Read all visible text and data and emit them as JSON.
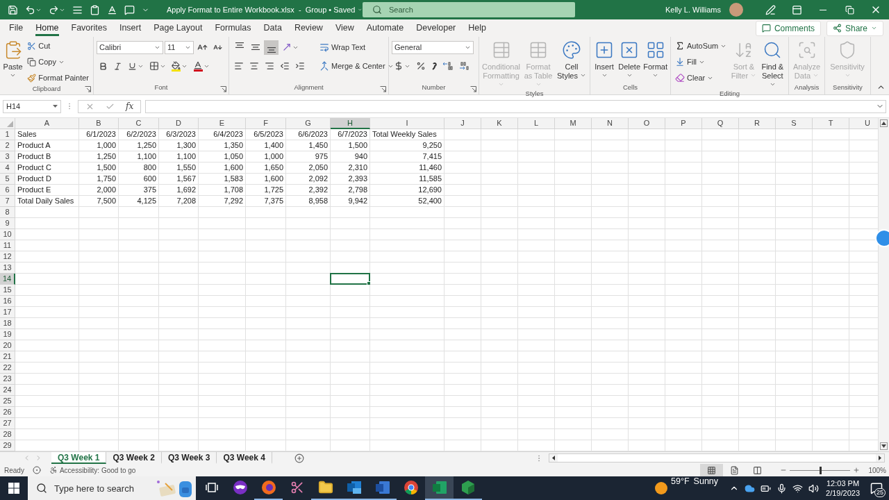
{
  "title_bar": {
    "title": "Apply Format to Entire Workbook.xlsx  -  Group • Saved",
    "search_placeholder": "Search",
    "user_name": "Kelly L. Williams"
  },
  "menu_tabs": [
    {
      "label": "File",
      "selected": false
    },
    {
      "label": "Home",
      "selected": true
    },
    {
      "label": "Favorites",
      "selected": false
    },
    {
      "label": "Insert",
      "selected": false
    },
    {
      "label": "Page Layout",
      "selected": false
    },
    {
      "label": "Formulas",
      "selected": false
    },
    {
      "label": "Data",
      "selected": false
    },
    {
      "label": "Review",
      "selected": false
    },
    {
      "label": "View",
      "selected": false
    },
    {
      "label": "Automate",
      "selected": false
    },
    {
      "label": "Developer",
      "selected": false
    },
    {
      "label": "Help",
      "selected": false
    }
  ],
  "comments_button": "Comments",
  "share_button": "Share",
  "ribbon": {
    "clipboard": {
      "label": "Clipboard",
      "paste": "Paste",
      "cut": "Cut",
      "copy": "Copy",
      "format_painter": "Format Painter"
    },
    "font": {
      "label": "Font",
      "font_name": "Calibri",
      "font_size": "11"
    },
    "alignment": {
      "label": "Alignment",
      "wrap_text": "Wrap Text",
      "merge": "Merge & Center",
      "vertical_align": [
        {
          "selected": false
        },
        {
          "selected": false
        },
        {
          "selected": true
        }
      ]
    },
    "number": {
      "label": "Number",
      "format": "General"
    },
    "styles": {
      "label": "Styles",
      "buttons": [
        {
          "label": "Conditional Formatting",
          "disabled": true
        },
        {
          "label": "Format as Table",
          "disabled": true
        },
        {
          "label": "Cell Styles",
          "disabled": false
        }
      ]
    },
    "cells": {
      "label": "Cells",
      "buttons": [
        "Insert",
        "Delete",
        "Format"
      ]
    },
    "editing": {
      "label": "Editing",
      "autosum": "AutoSum",
      "fill": "Fill",
      "clear": "Clear",
      "buttons": [
        {
          "label": "Sort & Filter",
          "disabled": true
        },
        {
          "label": "Find & Select",
          "disabled": false
        }
      ]
    },
    "analysis": {
      "label": "Analysis",
      "buttons": [
        {
          "label": "Analyze Data",
          "disabled": true
        }
      ]
    },
    "sensitivity": {
      "label": "Sensitivity",
      "buttons": [
        {
          "label": "Sensitivity",
          "disabled": true
        }
      ]
    }
  },
  "formula_bar": {
    "name_box": "H14",
    "function_label": "fx"
  },
  "sheet": {
    "columns": [
      {
        "label": "A",
        "selected": false
      },
      {
        "label": "B",
        "selected": false
      },
      {
        "label": "C",
        "selected": false
      },
      {
        "label": "D",
        "selected": false
      },
      {
        "label": "E",
        "selected": false
      },
      {
        "label": "F",
        "selected": false
      },
      {
        "label": "G",
        "selected": false
      },
      {
        "label": "H",
        "selected": true
      },
      {
        "label": "I",
        "selected": false
      },
      {
        "label": "J",
        "selected": false
      },
      {
        "label": "K",
        "selected": false
      },
      {
        "label": "L",
        "selected": false
      },
      {
        "label": "M",
        "selected": false
      },
      {
        "label": "N",
        "selected": false
      },
      {
        "label": "O",
        "selected": false
      },
      {
        "label": "P",
        "selected": false
      },
      {
        "label": "Q",
        "selected": false
      },
      {
        "label": "R",
        "selected": false
      },
      {
        "label": "S",
        "selected": false
      },
      {
        "label": "T",
        "selected": false
      },
      {
        "label": "U",
        "selected": false
      }
    ],
    "rows": [
      {
        "number": "1",
        "kind": "header",
        "selected": false,
        "cells": [
          "Sales",
          "6/1/2023",
          "6/2/2023",
          "6/3/2023",
          "6/4/2023",
          "6/5/2023",
          "6/6/2023",
          "6/7/2023",
          "Total Weekly Sales"
        ]
      },
      {
        "number": "2",
        "kind": "data",
        "selected": false,
        "cells": [
          "Product A",
          "1,000",
          "1,250",
          "1,300",
          "1,350",
          "1,400",
          "1,450",
          "1,500",
          "9,250"
        ]
      },
      {
        "number": "3",
        "kind": "data",
        "selected": false,
        "cells": [
          "Product B",
          "1,250",
          "1,100",
          "1,100",
          "1,050",
          "1,000",
          "975",
          "940",
          "7,415"
        ]
      },
      {
        "number": "4",
        "kind": "data",
        "selected": false,
        "cells": [
          "Product C",
          "1,500",
          "800",
          "1,550",
          "1,600",
          "1,650",
          "2,050",
          "2,310",
          "11,460"
        ]
      },
      {
        "number": "5",
        "kind": "data",
        "selected": false,
        "cells": [
          "Product D",
          "1,750",
          "600",
          "1,567",
          "1,583",
          "1,600",
          "2,092",
          "2,393",
          "11,585"
        ]
      },
      {
        "number": "6",
        "kind": "data",
        "selected": false,
        "cells": [
          "Product E",
          "2,000",
          "375",
          "1,692",
          "1,708",
          "1,725",
          "2,392",
          "2,798",
          "12,690"
        ]
      },
      {
        "number": "7",
        "kind": "data",
        "selected": false,
        "cells": [
          "Total Daily Sales",
          "7,500",
          "4,125",
          "7,208",
          "7,292",
          "7,375",
          "8,958",
          "9,942",
          "52,400"
        ]
      },
      {
        "number": "8",
        "kind": "empty",
        "selected": false
      },
      {
        "number": "9",
        "kind": "empty",
        "selected": false
      },
      {
        "number": "10",
        "kind": "empty",
        "selected": false
      },
      {
        "number": "11",
        "kind": "empty",
        "selected": false
      },
      {
        "number": "12",
        "kind": "empty",
        "selected": false
      },
      {
        "number": "13",
        "kind": "empty",
        "selected": false
      },
      {
        "number": "14",
        "kind": "empty",
        "selected": true
      },
      {
        "number": "15",
        "kind": "empty",
        "selected": false
      },
      {
        "number": "16",
        "kind": "empty",
        "selected": false
      },
      {
        "number": "17",
        "kind": "empty",
        "selected": false
      },
      {
        "number": "18",
        "kind": "empty",
        "selected": false
      },
      {
        "number": "19",
        "kind": "empty",
        "selected": false
      },
      {
        "number": "20",
        "kind": "empty",
        "selected": false
      },
      {
        "number": "21",
        "kind": "empty",
        "selected": false
      },
      {
        "number": "22",
        "kind": "empty",
        "selected": false
      },
      {
        "number": "23",
        "kind": "empty",
        "selected": false
      },
      {
        "number": "24",
        "kind": "empty",
        "selected": false
      },
      {
        "number": "25",
        "kind": "empty",
        "selected": false
      },
      {
        "number": "26",
        "kind": "empty",
        "selected": false
      },
      {
        "number": "27",
        "kind": "empty",
        "selected": false
      },
      {
        "number": "28",
        "kind": "empty",
        "selected": false
      },
      {
        "number": "29",
        "kind": "empty",
        "selected": false
      }
    ]
  },
  "sheet_tabs": [
    {
      "label": "Q3 Week 1",
      "selected": true
    },
    {
      "label": "Q3 Week 2",
      "selected": false
    },
    {
      "label": "Q3 Week 3",
      "selected": false
    },
    {
      "label": "Q3 Week 4",
      "selected": false
    }
  ],
  "status_bar": {
    "mode": "Ready",
    "accessibility": "Accessibility: Good to go",
    "views": [
      {
        "kind": "normal",
        "selected": true
      },
      {
        "kind": "page-layout",
        "selected": false
      },
      {
        "kind": "page-break",
        "selected": false
      }
    ],
    "zoom": {
      "level": 0.5,
      "reading": "100%"
    }
  },
  "taskbar": {
    "search_placeholder": "Type here to search",
    "apps": [
      {
        "kind": "taskview",
        "running": false,
        "selected": false
      },
      {
        "kind": "mask",
        "running": false,
        "selected": false
      },
      {
        "kind": "fox",
        "running": true,
        "selected": false
      },
      {
        "kind": "snip",
        "running": false,
        "selected": false
      },
      {
        "kind": "folder",
        "running": true,
        "selected": false
      },
      {
        "kind": "mail",
        "running": true,
        "selected": false
      },
      {
        "kind": "word",
        "running": true,
        "selected": false
      },
      {
        "kind": "chrome",
        "running": false,
        "selected": false
      },
      {
        "kind": "sheet",
        "running": true,
        "selected": true
      },
      {
        "kind": "cube",
        "running": true,
        "selected": false
      }
    ],
    "temperature": "59°F",
    "weather": "Sunny",
    "time": "12:03 PM",
    "date": "2/19/2023",
    "notifications": "25"
  }
}
